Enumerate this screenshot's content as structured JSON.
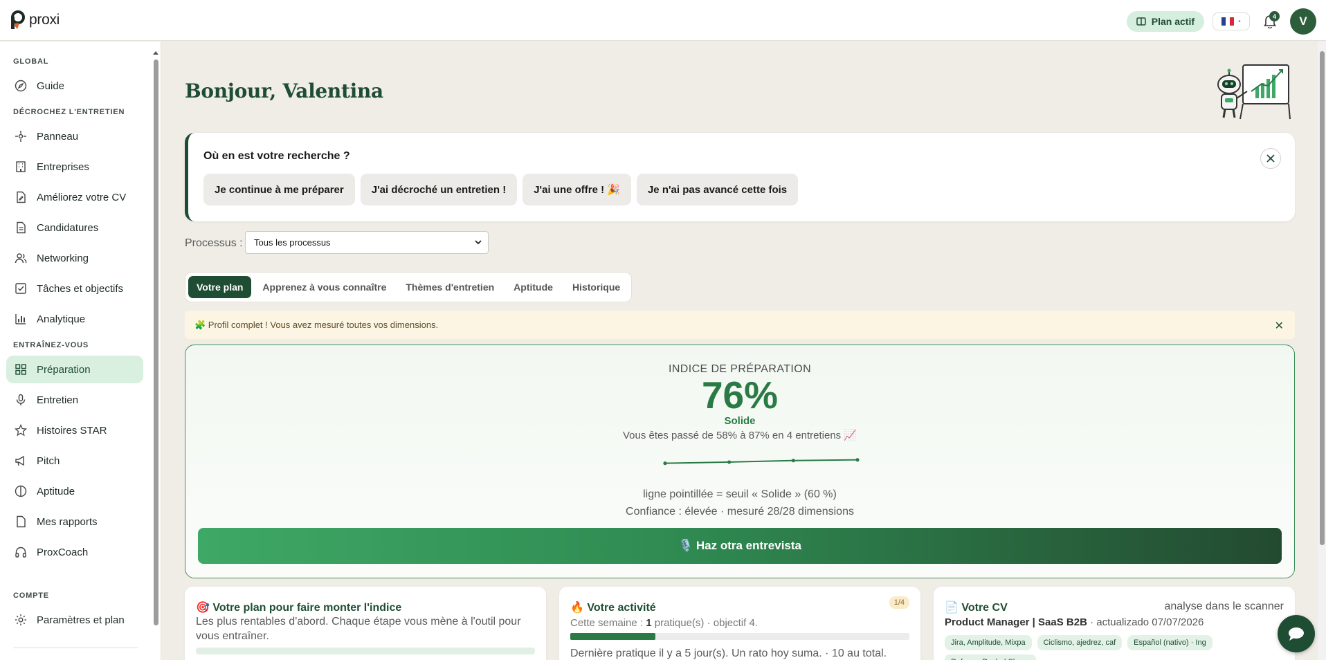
{
  "app": {
    "brand": "proxi"
  },
  "header": {
    "plan_label": "Plan actif",
    "notifications_count": "4",
    "avatar_initial": "V"
  },
  "sidebar": {
    "sections": [
      "GLOBAL",
      "DÉCROCHEZ L'ENTRETIEN",
      "ENTRAÎNEZ-VOUS",
      "COMPTE"
    ],
    "items": [
      {
        "label": "Guide",
        "icon": "compass-icon"
      },
      {
        "label": "Panneau",
        "icon": "target-icon"
      },
      {
        "label": "Entreprises",
        "icon": "building-icon"
      },
      {
        "label": "Améliorez votre CV",
        "icon": "file-edit-icon"
      },
      {
        "label": "Candidatures",
        "icon": "file-text-icon"
      },
      {
        "label": "Networking",
        "icon": "users-icon"
      },
      {
        "label": "Tâches et objectifs",
        "icon": "checkbox-icon"
      },
      {
        "label": "Analytique",
        "icon": "bar-chart-icon"
      },
      {
        "label": "Préparation",
        "icon": "grid-icon",
        "active": true
      },
      {
        "label": "Entretien",
        "icon": "microphone-icon"
      },
      {
        "label": "Histoires STAR",
        "icon": "star-icon"
      },
      {
        "label": "Pitch",
        "icon": "megaphone-icon"
      },
      {
        "label": "Aptitude",
        "icon": "brain-icon"
      },
      {
        "label": "Mes rapports",
        "icon": "document-icon"
      },
      {
        "label": "ProxCoach",
        "icon": "headphones-icon"
      },
      {
        "label": "Paramètres et plan",
        "icon": "gear-icon"
      }
    ]
  },
  "main": {
    "greeting": "Bonjour, Valentina",
    "search_status": {
      "question": "Où en est votre recherche ?",
      "choices": [
        "Je continue à me préparer",
        "J'ai décroché un entretien !",
        "J'ai une offre ! 🎉",
        "Je n'ai pas avancé cette fois"
      ]
    },
    "process": {
      "label": "Processus :",
      "selected": "Tous les processus"
    },
    "tabs": [
      "Votre plan",
      "Apprenez à vous connaître",
      "Thèmes d'entretien",
      "Aptitude",
      "Historique"
    ],
    "notice": "🧩 Profil complet ! Vous avez mesuré toutes vos dimensions.",
    "readiness": {
      "title": "INDICE DE PRÉPARATION",
      "value": "76%",
      "level": "Solide",
      "trend": "Vous êtes passé de 58% à 87% en 4 entretiens 📈",
      "spark_values": [
        58,
        68,
        81,
        87
      ],
      "threshold": "ligne pointillée = seuil « Solide » (60 %)",
      "confidence": "Confiance : élevée · mesuré 28/28 dimensions",
      "cta": "🎙️ Haz otra entrevista"
    },
    "cards": {
      "plan": {
        "title": "🎯 Votre plan pour faire monter l'indice",
        "subtitle": "Les plus rentables d'abord. Chaque étape vous mène à l'outil pour vous entraîner."
      },
      "activity": {
        "title": "🔥 Votre activité",
        "badge": "1/4",
        "week_prefix": "Cette semaine : ",
        "week_count": "1",
        "week_suffix": " pratique(s) · objectif 4.",
        "progress": 0.25,
        "last": "Dernière pratique il y a 5 jour(s). Un rato hoy suma. · 10 au total."
      },
      "cv": {
        "title": "📄 Votre CV",
        "scanner": "analyse dans le scanner",
        "role": "Product Manager | SaaS B2B",
        "updated": " · actualizado 07/07/2026",
        "tags": [
          "Jira, Amplitude, Mixpa",
          "Ciclismo, ajedrez, caf",
          "Español (nativo) · Ing"
        ],
        "tag_more": "Referee: Rachel Sh"
      }
    }
  },
  "colors": {
    "brand_green": "#1f4d33",
    "accent_green": "#2a7a45",
    "active_bg": "#d9f0e0"
  }
}
